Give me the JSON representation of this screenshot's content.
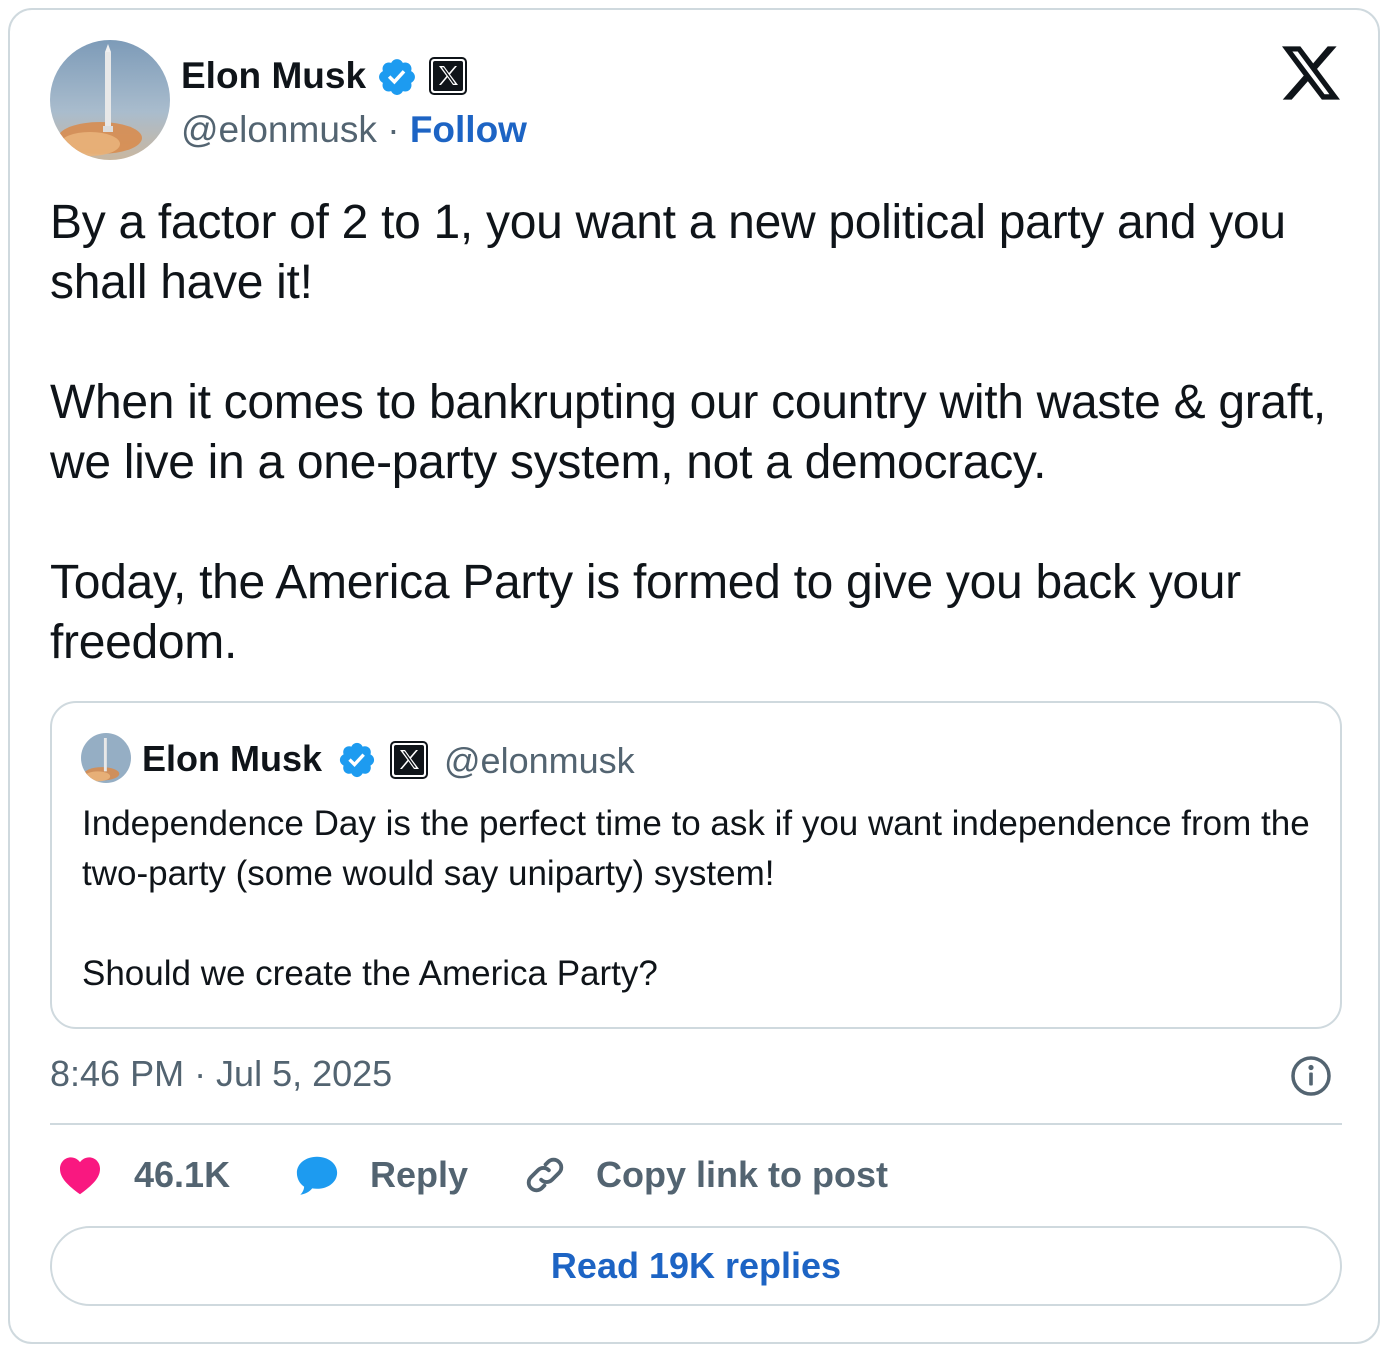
{
  "author": {
    "name": "Elon Musk",
    "handle": "@elonmusk",
    "separator": " · ",
    "follow_label": "Follow",
    "verified": true,
    "affiliate_badge_icon": "x-badge-icon",
    "avatar_icon": "rocket-avatar"
  },
  "post": {
    "text": "By a factor of 2 to 1, you want a new political party and you shall have it!\n\nWhen it comes to bankrupting our country with waste & graft, we live in a one-party system, not a democracy.\n\nToday, the America Party is formed to give you back your freedom.",
    "timestamp": "8:46 PM · Jul 5, 2025"
  },
  "quoted_post": {
    "name": "Elon Musk",
    "handle": "@elonmusk",
    "text": "Independence Day is the perfect time to ask if you want independence from the two-party (some would say uniparty) system!\n\nShould we create the America Party?"
  },
  "actions": {
    "like_count": "46.1K",
    "reply_label": "Reply",
    "copy_label": "Copy link to post"
  },
  "read_replies_label": "Read 19K replies",
  "colors": {
    "link": "#1d64c4",
    "secondary_text": "#536471",
    "border": "#cfd9de",
    "like": "#f91880",
    "reply": "#1d9bf0",
    "verified": "#1d9bf0"
  }
}
